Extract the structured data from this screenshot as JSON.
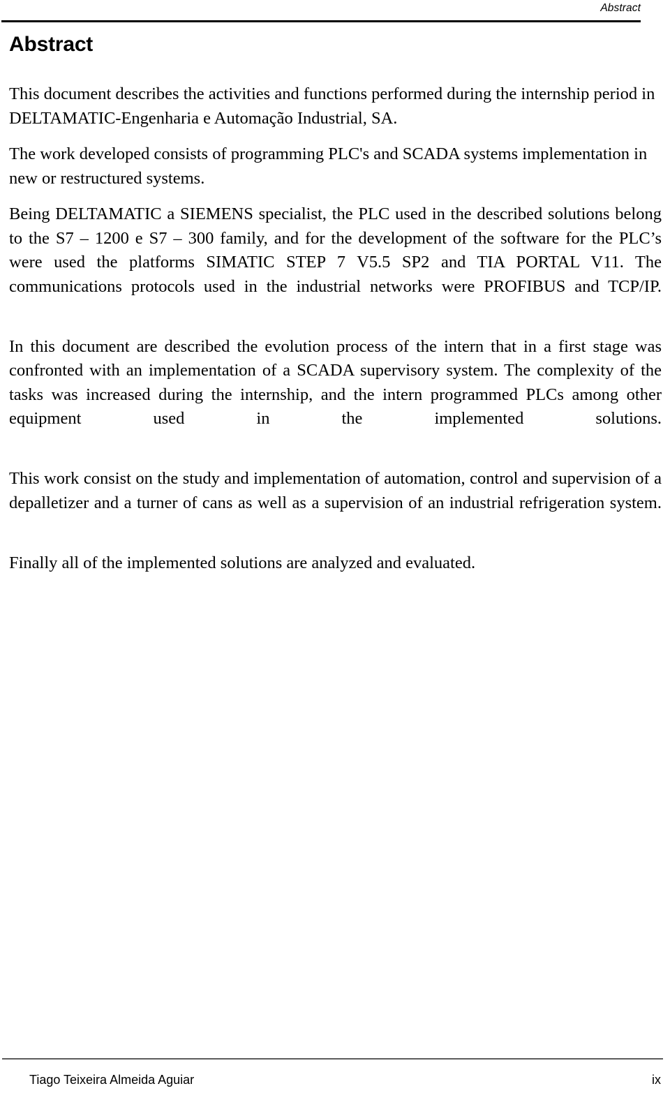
{
  "header": {
    "running_title": "Abstract"
  },
  "main": {
    "section_title": "Abstract",
    "paragraphs": [
      "This document describes the activities and functions performed during the internship period in DELTAMATIC-Engenharia e Automação Industrial, SA.",
      "The work developed consists of programming PLC's and SCADA systems implementation in new or restructured systems.",
      "Being DELTAMATIC a SIEMENS specialist, the PLC used in the described solutions belong to the S7 – 1200 e S7 – 300 family, and for the development of the software for the PLC’s were used the platforms SIMATIC STEP 7 V5.5 SP2 and TIA PORTAL V11. The communications protocols used in the industrial networks were PROFIBUS and TCP/IP.",
      "In this document are described the evolution process of the intern that in a first stage was confronted with an implementation of a SCADA supervisory system. The complexity of the tasks was increased during the internship, and the intern programmed PLCs among other equipment used in the implemented solutions.",
      "This work consist on the study and implementation of automation, control and supervision of a depalletizer and a turner of cans as well as a supervision of an industrial refrigeration system.",
      "Finally all of the implemented solutions are analyzed and evaluated."
    ]
  },
  "footer": {
    "author": "Tiago Teixeira Almeida Aguiar",
    "page_number": "ix"
  },
  "colors": {
    "text": "#000000",
    "header_rule": "#000000",
    "footer_rule": "#5c5c5c",
    "page_background": "#ffffff"
  }
}
